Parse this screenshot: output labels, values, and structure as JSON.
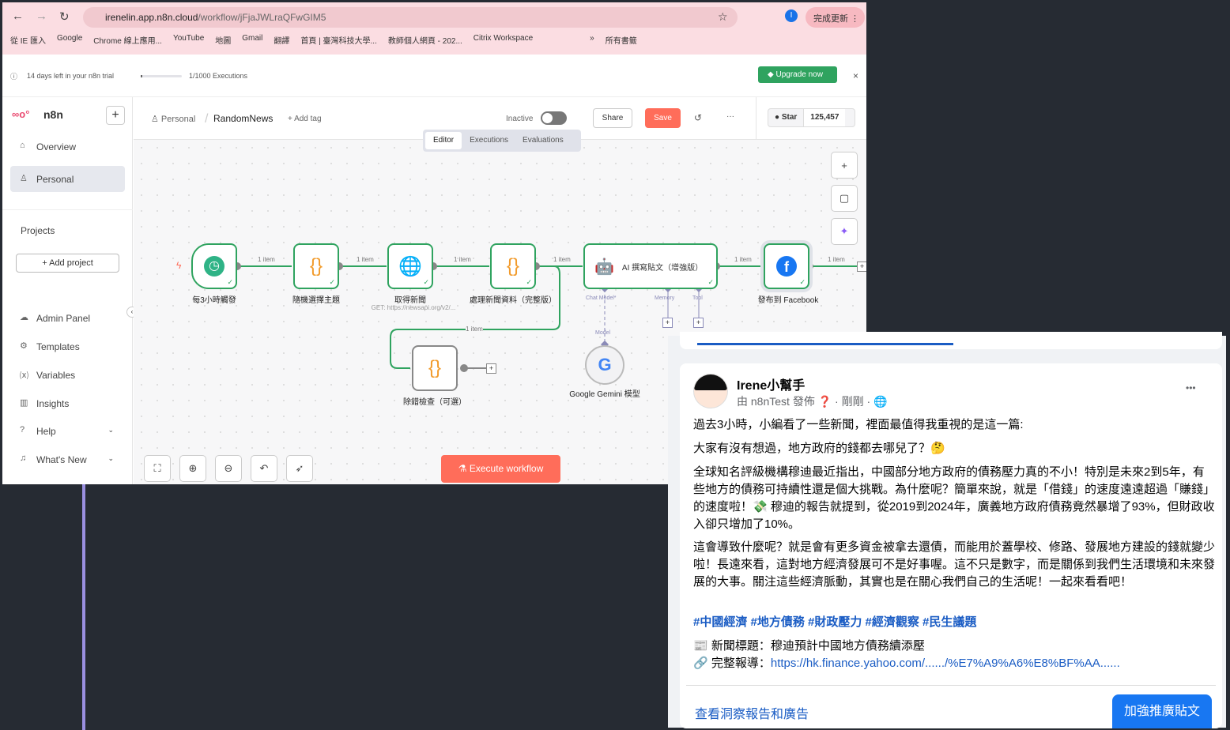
{
  "browser": {
    "url_host": "irenelin.app.n8n.cloud",
    "url_path": "/workflow/jFjaJWLraQFwGIM5",
    "update_label": "完成更新",
    "profile": "I",
    "bookmarks": [
      "從 IE 匯入",
      "Google",
      "Chrome 線上應用...",
      "YouTube",
      "地圖",
      "Gmail",
      "翻譯",
      "首頁 | 臺灣科技大學...",
      "教師個人網頁 - 202...",
      "Citrix Workspace",
      "»",
      "所有書籤"
    ]
  },
  "trial": {
    "text": "14 days left in your n8n trial",
    "executions": "1/1000 Executions",
    "progress": 0.001,
    "upgrade_label": "Upgrade now",
    "close": "×"
  },
  "sidebar": {
    "brand": "n8n",
    "add": "+",
    "items": [
      {
        "icon": "⌂",
        "label": "Overview"
      },
      {
        "icon": "♙",
        "label": "Personal"
      }
    ],
    "projects_title": "Projects",
    "add_project": "+ Add project",
    "bottom": [
      {
        "icon": "☁",
        "label": "Admin Panel"
      },
      {
        "icon": "⚙",
        "label": "Templates"
      },
      {
        "icon": "⒳",
        "label": "Variables"
      },
      {
        "icon": "▥",
        "label": "Insights"
      },
      {
        "icon": "?",
        "label": "Help"
      },
      {
        "icon": "♫",
        "label": "What's New"
      }
    ]
  },
  "header": {
    "project": "Personal",
    "workflow": "RandomNews",
    "add_tag": "+ Add tag",
    "status": "Inactive",
    "share": "Share",
    "save": "Save",
    "more": "···",
    "star": "Star",
    "star_count": "125,457",
    "tabs": [
      "Editor",
      "Executions",
      "Evaluations"
    ]
  },
  "canvas": {
    "nodes": [
      "每3小時觸發",
      "隨機選擇主題",
      "取得新聞",
      "處理新聞資料（完整版）",
      "AI 撰寫貼文（增強版）",
      "發布到 Facebook",
      "除錯檢查（可選）",
      "Google Gemini 模型"
    ],
    "node_subtitle": "GET: https://newsapi.org/v2/...",
    "edge_label": "1 item",
    "ports": [
      "Chat Model*",
      "Memory",
      "Tool",
      "Model"
    ],
    "execute": "Execute workflow"
  },
  "facebook": {
    "author": "Irene小幫手",
    "meta": "由 n8nTest 發佈",
    "time": "剛剛",
    "more": "•••",
    "paragraphs": [
      "過去3小時，小編看了一些新聞，裡面最值得我重視的是這一篇:",
      "大家有沒有想過，地方政府的錢都去哪兒了？🤔",
      "全球知名評級機構穆迪最近指出，中國部分地方政府的債務壓力真的不小！特別是未來2到5年，有些地方的債務可持續性還是個大挑戰。為什麼呢？簡單來說，就是「借錢」的速度遠遠超過「賺錢」的速度啦！💸 穆迪的報告就提到，從2019到2024年，廣義地方政府債務竟然暴增了93%，但財政收入卻只增加了10%。",
      "這會導致什麼呢？就是會有更多資金被拿去還債，而能用於蓋學校、修路、發展地方建設的錢就變少啦！長遠來看，這對地方經濟發展可不是好事喔。這不只是數字，而是關係到我們生活環境和未來發展的大事。關注這些經濟脈動，其實也是在關心我們自己的生活呢！一起來看看吧！"
    ],
    "hashtags": "#中國經濟 #地方債務 #財政壓力 #經濟觀察 #民生議題",
    "news_title": "新聞標題：穆迪預計中國地方債務續添壓",
    "link_label": "完整報導：",
    "link": "https://hk.finance.yahoo.com/....../%E7%A9%A6%E8%BF%AA......",
    "insights": "查看洞察報告和廣告",
    "boost": "加強推廣貼文"
  }
}
